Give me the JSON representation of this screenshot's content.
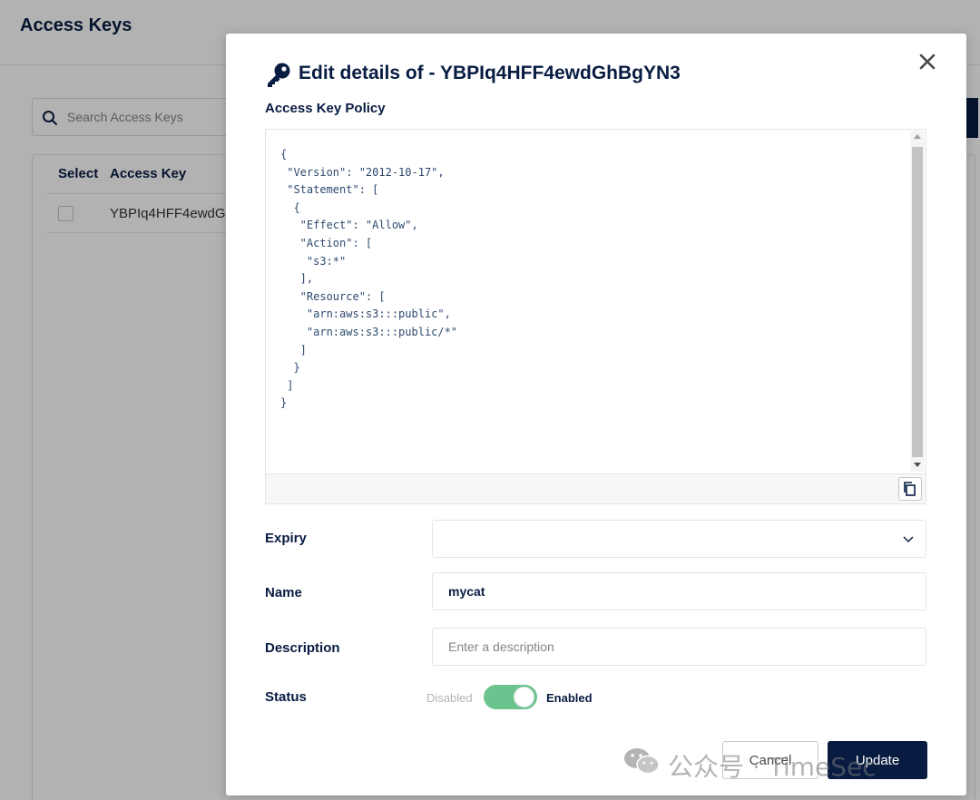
{
  "background": {
    "page_title": "Access Keys",
    "search": {
      "placeholder": "Search Access Keys"
    },
    "table": {
      "headers": [
        "Select",
        "Access Key"
      ],
      "rows": [
        {
          "access_key": "YBPIq4HFF4ewdG"
        }
      ]
    }
  },
  "modal": {
    "title": "Edit details of - YBPIq4HFF4ewdGhBgYN3",
    "policy_label": "Access Key Policy",
    "policy_lines": [
      "{",
      " \"Version\": \"2012-10-17\",",
      " \"Statement\": [",
      "  {",
      "   \"Effect\": \"Allow\",",
      "   \"Action\": [",
      "    \"s3:*\"",
      "   ],",
      "   \"Resource\": [",
      "    \"arn:aws:s3:::public\",",
      "    \"arn:aws:s3:::public/*\"",
      "   ]",
      "  }",
      " ]",
      "}"
    ],
    "expiry": {
      "label": "Expiry",
      "value": ""
    },
    "name": {
      "label": "Name",
      "value": "mycat"
    },
    "description": {
      "label": "Description",
      "placeholder": "Enter a description",
      "value": ""
    },
    "status": {
      "label": "Status",
      "off_label": "Disabled",
      "on_label": "Enabled",
      "enabled": true
    },
    "buttons": {
      "cancel": "Cancel",
      "update": "Update"
    }
  },
  "watermark": {
    "text": "公众号 · TimeSec"
  },
  "icons": {
    "search": "search-icon",
    "key": "key-icon",
    "close": "close-icon",
    "copy": "copy-icon",
    "chevron": "chevron-down-icon",
    "wechat": "wechat-logo"
  },
  "colors": {
    "navy": "#081c42",
    "toggle_on": "#6bc48d",
    "overlay": "rgba(0,0,0,0.30)"
  }
}
